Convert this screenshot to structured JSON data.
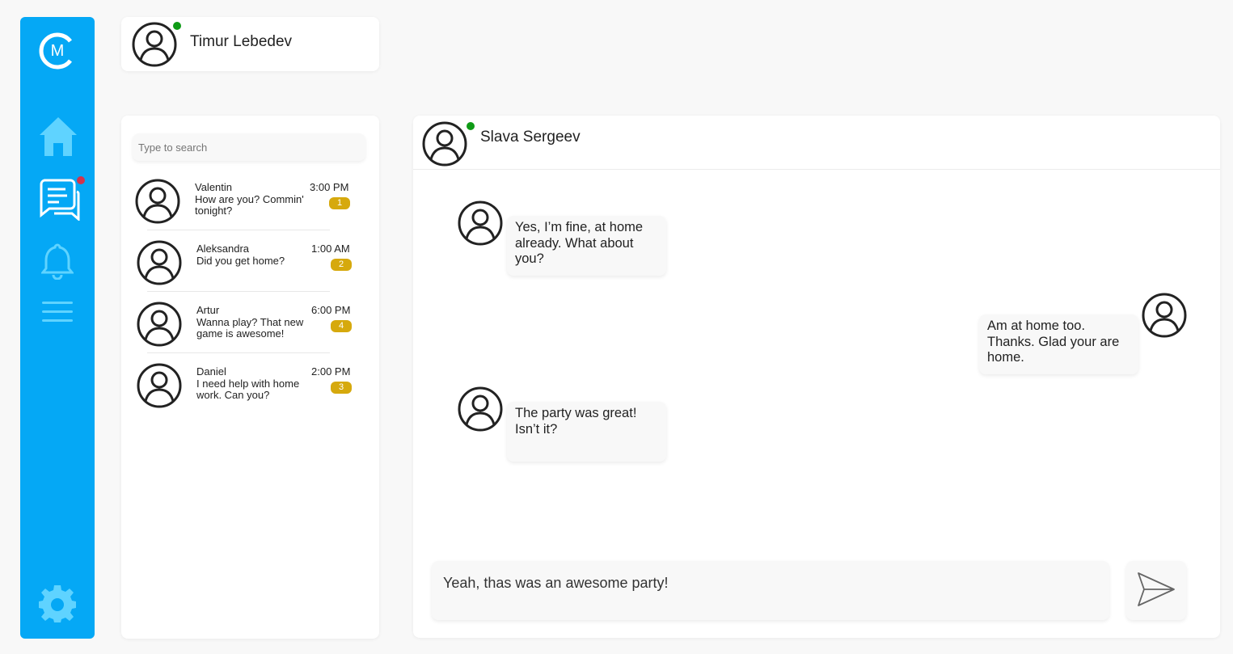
{
  "brand": {
    "logo_letter": "M",
    "accent_color": "#05a8f5"
  },
  "sidebar": {
    "items": [
      {
        "icon": "home-icon"
      },
      {
        "icon": "chat-icon",
        "has_notification": true
      },
      {
        "icon": "bell-icon"
      },
      {
        "icon": "menu-icon"
      }
    ],
    "settings_icon": "gear-icon"
  },
  "profile": {
    "name": "Timur Lebedev",
    "online": true
  },
  "search": {
    "placeholder": "Type to search"
  },
  "conversations": [
    {
      "name": "Valentin",
      "time": "3:00 PM",
      "preview": "How are you? Commin' tonight?",
      "unread": "1"
    },
    {
      "name": "Aleksandra",
      "time": "1:00 AM",
      "preview": "Did you get home?",
      "unread": "2"
    },
    {
      "name": "Artur",
      "time": "6:00 PM",
      "preview": "Wanna play? That new game is awesome!",
      "unread": "4"
    },
    {
      "name": "Daniel",
      "time": "2:00 PM",
      "preview": "I need help with home work. Can you?",
      "unread": "3"
    }
  ],
  "chat": {
    "contact_name": "Slava Sergeev",
    "online": true,
    "messages": [
      {
        "from": "them",
        "text": "Yes, I’m fine, at home already. What about you?"
      },
      {
        "from": "me",
        "text": "Am at home too. Thanks. Glad your are home."
      },
      {
        "from": "them",
        "text": "The party was great! Isn’t it?"
      }
    ],
    "compose_value": "Yeah, thas was an awesome party!",
    "send_icon": "send-icon"
  },
  "colors": {
    "online": "#0f9b16",
    "badge": "#d6a90d",
    "notification": "#d2344e"
  }
}
